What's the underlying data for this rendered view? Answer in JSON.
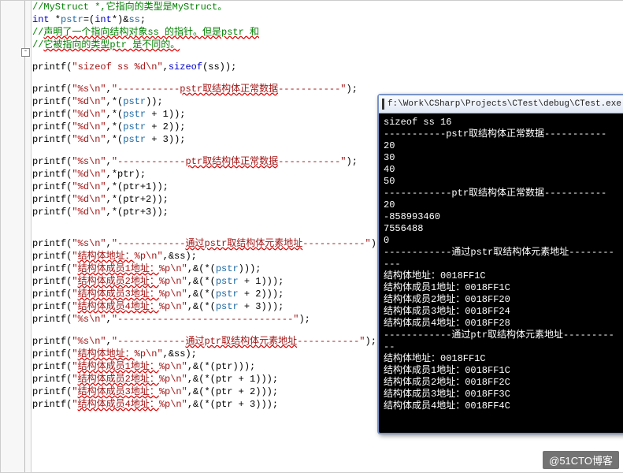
{
  "code_lines": [
    {
      "type": "comment",
      "html": "//MyStruct *,它指向的类型是MyStruct。"
    },
    {
      "type": "decl",
      "html": "<span class='c-key'>int</span> *<span class='c-var'>pstr</span>=(<span class='c-key'>int</span>*)&<span class='c-var'>ss</span>;"
    },
    {
      "type": "comment-wavy",
      "html": "//<span class='wavy'>声明了一个指向结构对象ss 的指针。但是pstr 和</span>"
    },
    {
      "type": "comment-wavy",
      "html": "//<span class='wavy'>它被指向的类型ptr 是不同的。</span>"
    },
    {
      "type": "blank"
    },
    {
      "type": "code",
      "html": "printf(<span class='c-str'>\"sizeof ss %d\\n\"</span>,<span class='c-key'>sizeof</span>(ss));"
    },
    {
      "type": "blank"
    },
    {
      "type": "code",
      "html": "printf(<span class='c-str'>\"%s\\n\"</span>,<span class='c-str'>\"-----------<span class='wavy'>pstr取结构体正常数据</span>-----------\"</span>);"
    },
    {
      "type": "code",
      "html": "printf(<span class='c-str'>\"%d\\n\"</span>,*(<span class='c-var'>pstr</span>));"
    },
    {
      "type": "code",
      "html": "printf(<span class='c-str'>\"%d\\n\"</span>,*(<span class='c-var'>pstr</span> + 1));"
    },
    {
      "type": "code",
      "html": "printf(<span class='c-str'>\"%d\\n\"</span>,*(<span class='c-var'>pstr</span> + 2));"
    },
    {
      "type": "code",
      "html": "printf(<span class='c-str'>\"%d\\n\"</span>,*(<span class='c-var'>pstr</span> + 3));"
    },
    {
      "type": "blank"
    },
    {
      "type": "code",
      "html": "printf(<span class='c-str'>\"%s\\n\"</span>,<span class='c-str'>\"------------<span class='wavy'>ptr取结构体正常数据</span>-----------\"</span>);"
    },
    {
      "type": "code",
      "html": "printf(<span class='c-str'>\"%d\\n\"</span>,*ptr);"
    },
    {
      "type": "code",
      "html": "printf(<span class='c-str'>\"%d\\n\"</span>,*(ptr+1));"
    },
    {
      "type": "code",
      "html": "printf(<span class='c-str'>\"%d\\n\"</span>,*(ptr+2));"
    },
    {
      "type": "code",
      "html": "printf(<span class='c-str'>\"%d\\n\"</span>,*(ptr+3));"
    },
    {
      "type": "blank"
    },
    {
      "type": "blank"
    },
    {
      "type": "code",
      "html": "printf(<span class='c-str'>\"%s\\n\"</span>,<span class='c-str'>\"------------<span class='wavy'>通过pstr取结构体元素地址</span>-----------\"</span>);"
    },
    {
      "type": "code",
      "html": "printf(<span class='c-str'>\"<span class='wavy'>结构体地址：</span>%p\\n\"</span>,&ss);"
    },
    {
      "type": "code",
      "html": "printf(<span class='c-str'>\"<span class='wavy'>结构体成员1地址：</span>%p\\n\"</span>,&(*(<span class='c-var'>pstr</span>)));"
    },
    {
      "type": "code",
      "html": "printf(<span class='c-str'>\"<span class='wavy'>结构体成员2地址：</span>%p\\n\"</span>,&(*(<span class='c-var'>pstr</span> + 1)));"
    },
    {
      "type": "code",
      "html": "printf(<span class='c-str'>\"<span class='wavy'>结构体成员3地址：</span>%p\\n\"</span>,&(*(<span class='c-var'>pstr</span> + 2)));"
    },
    {
      "type": "code",
      "html": "printf(<span class='c-str'>\"<span class='wavy'>结构体成员4地址：</span>%p\\n\"</span>,&(*(<span class='c-var'>pstr</span> + 3)));"
    },
    {
      "type": "code",
      "html": "printf(<span class='c-str'>\"%s\\n\"</span>,<span class='c-str'>\"-------------------------------\"</span>);"
    },
    {
      "type": "blank"
    },
    {
      "type": "code",
      "html": "printf(<span class='c-str'>\"%s\\n\"</span>,<span class='c-str'>\"------------<span class='wavy'>通过ptr取结构体元素地址</span>-----------\"</span>);"
    },
    {
      "type": "code",
      "html": "printf(<span class='c-str'>\"<span class='wavy'>结构体地址：</span>%p\\n\"</span>,&ss);"
    },
    {
      "type": "code",
      "html": "printf(<span class='c-str'>\"<span class='wavy'>结构体成员1地址：</span>%p\\n\"</span>,&(*(ptr)));"
    },
    {
      "type": "code",
      "html": "printf(<span class='c-str'>\"<span class='wavy'>结构体成员2地址：</span>%p\\n\"</span>,&(*(ptr + 1)));"
    },
    {
      "type": "code",
      "html": "printf(<span class='c-str'>\"<span class='wavy'>结构体成员3地址：</span>%p\\n\"</span>,&(*(ptr + 2)));"
    },
    {
      "type": "code",
      "html": "printf(<span class='c-str'>\"<span class='wavy'>结构体成员4地址：</span>%p\\n\"</span>,&(*(ptr + 3)));"
    }
  ],
  "console": {
    "title": "f:\\Work\\CSharp\\Projects\\CTest\\debug\\CTest.exe",
    "lines": [
      "sizeof ss 16",
      "-----------pstr取结构体正常数据-----------",
      "20",
      "30",
      "40",
      "50",
      "------------ptr取结构体正常数据-----------",
      "20",
      "-858993460",
      "7556488",
      "0",
      "------------通过pstr取结构体元素地址-----------",
      "结构体地址：0018FF1C",
      "结构体成员1地址：0018FF1C",
      "结构体成员2地址：0018FF20",
      "结构体成员3地址：0018FF24",
      "结构体成员4地址：0018FF28",
      "",
      "------------通过ptr取结构体元素地址-----------",
      "结构体地址：0018FF1C",
      "结构体成员1地址：0018FF1C",
      "结构体成员2地址：0018FF2C",
      "结构体成员3地址：0018FF3C",
      "结构体成员4地址：0018FF4C"
    ]
  },
  "watermark": "@51CTO博客"
}
